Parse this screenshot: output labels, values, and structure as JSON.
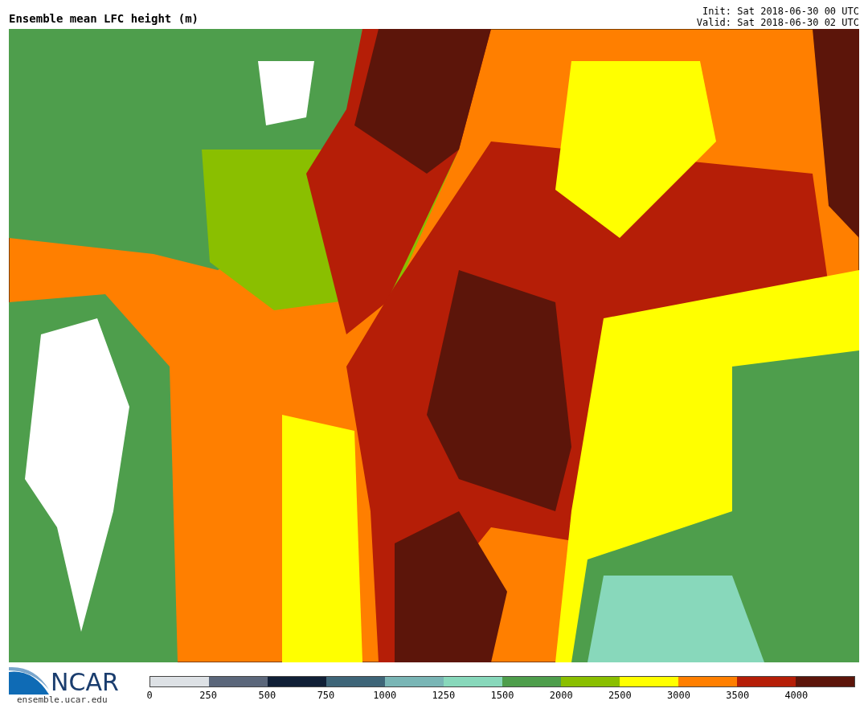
{
  "header": {
    "title": "Ensemble mean LFC height (m)",
    "init": "Init: Sat 2018-06-30 00 UTC",
    "valid": "Valid: Sat 2018-06-30 02 UTC"
  },
  "logo": {
    "text": "NCAR",
    "url": "ensemble.ucar.edu"
  },
  "colorbar": {
    "segments": [
      {
        "color": "#dde1e5"
      },
      {
        "color": "#5b677b"
      },
      {
        "color": "#101f36"
      },
      {
        "color": "#3e6578"
      },
      {
        "color": "#79b5b5"
      },
      {
        "color": "#88d8bb"
      },
      {
        "color": "#4e9e4c"
      },
      {
        "color": "#8abf00"
      },
      {
        "color": "#ffff00"
      },
      {
        "color": "#ff7f00"
      },
      {
        "color": "#b51e07"
      },
      {
        "color": "#5c150a"
      }
    ],
    "labels": [
      "0",
      "250",
      "500",
      "750",
      "1000",
      "1250",
      "1500",
      "2000",
      "2500",
      "3000",
      "3500",
      "4000"
    ]
  }
}
